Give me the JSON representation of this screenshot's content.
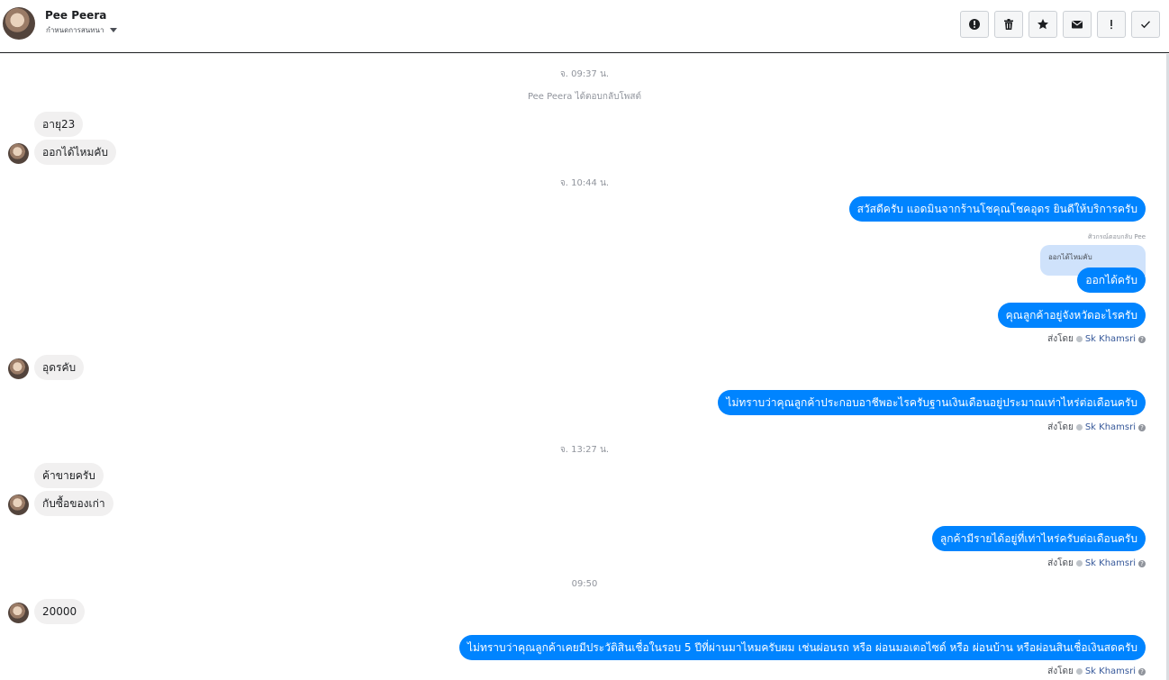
{
  "header": {
    "name": "Pee Peera",
    "status": "กำหนดการสนทนา",
    "actions": [
      {
        "name": "alert-circle-icon"
      },
      {
        "name": "trash-icon"
      },
      {
        "name": "star-icon"
      },
      {
        "name": "envelope-icon"
      },
      {
        "name": "exclamation-icon"
      },
      {
        "name": "check-icon"
      }
    ]
  },
  "conversation": {
    "ts1": "จ. 09:37 น.",
    "sys1": "Pee Peera ได้ตอบกลับโพสต์",
    "m1": "อายุ23",
    "m2": "ออกได้ไหมคับ",
    "ts2": "จ. 10:44 น.",
    "m3": "สวัสดีครับ แอดมินจากร้านโชคุณโชคอุดร ยินดีให้บริการครับ",
    "reply_note": "ศิวกรณ์ตอบกลับ Pee",
    "quoted": "ออกได้ไหมคับ",
    "m4": "ออกได้ครับ",
    "m5": "คุณลูกค้าอยู่จังหวัดอะไรครับ",
    "sent_by_label": "ส่งโดย",
    "sent_by_name": "Sk Khamsri",
    "m6": "อุดรคับ",
    "m7": "ไม่ทราบว่าคุณลูกค้าประกอบอาชีพอะไรครับฐานเงินเดือนอยู่ประมาณเท่าไหร่ต่อเดือนครับ",
    "ts3": "จ. 13:27 น.",
    "m8": "ค้าขายครับ",
    "m9": "กับซื้อของเก่า",
    "m10": "ลูกค้ามีรายได้อยู่ที่เท่าไหร่ครับต่อเดือนครับ",
    "ts4": "09:50",
    "m11": "20000",
    "m12": "ไม่ทราบว่าคุณลูกค้าเคยมีประวัติสินเชื่อในรอบ 5 ปีที่ผ่านมาไหมครับผม เช่นผ่อนรถ หรือ ผ่อนมอเตอไซด์ หรือ ผ่อนบ้าน หรือผ่อนสินเชื่อเงินสดครับ"
  },
  "colors": {
    "outgoing": "#0084ff",
    "incoming": "#f1f0f0",
    "quoted": "#cfe2fb"
  }
}
